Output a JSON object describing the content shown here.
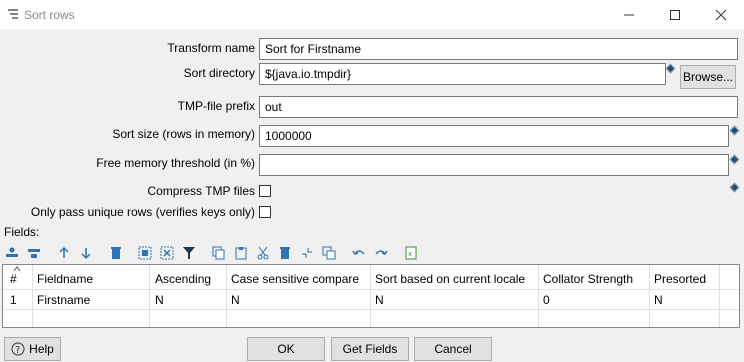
{
  "window": {
    "title": "Sort rows",
    "icons": [
      "sort-icon",
      "minimize-icon",
      "maximize-icon",
      "close-icon"
    ]
  },
  "form": {
    "transform_name_label": "Transform name",
    "transform_name_value": "Sort for Firstname",
    "sort_directory_label": "Sort directory",
    "sort_directory_value": "${java.io.tmpdir}",
    "browse_label": "Browse...",
    "tmp_prefix_label": "TMP-file prefix",
    "tmp_prefix_value": "out",
    "sort_size_label": "Sort size (rows in memory)",
    "sort_size_value": "1000000",
    "free_memory_label": "Free memory threshold (in %)",
    "free_memory_value": "",
    "compress_label": "Compress TMP files",
    "compress_checked": false,
    "unique_label": "Only pass unique rows (verifies keys only)",
    "unique_checked": false
  },
  "fields": {
    "label": "Fields:",
    "toolbar_icons": [
      "insert-row-icon",
      "delete-row-icon",
      "move-up-icon",
      "move-down-icon",
      "clear-icon",
      "select-all-icon",
      "deselect-icon",
      "filter-icon",
      "copy-icon",
      "paste-icon",
      "cut-icon",
      "delete-icon",
      "collapse-icon",
      "duplicate-icon",
      "undo-icon",
      "redo-icon",
      "export-icon"
    ],
    "columns": [
      "#",
      "Fieldname",
      "Ascending",
      "Case sensitive compare",
      "Sort based on current locale",
      "Collator Strength",
      "Presorted"
    ],
    "rows": [
      [
        "1",
        "Firstname",
        "N",
        "N",
        "N",
        "0",
        "N"
      ]
    ]
  },
  "buttons": {
    "help": "Help",
    "ok": "OK",
    "get_fields": "Get Fields",
    "cancel": "Cancel"
  },
  "colors": {
    "toolbar_blue": "#2e75b6",
    "diamond": "#2b4a6b"
  }
}
